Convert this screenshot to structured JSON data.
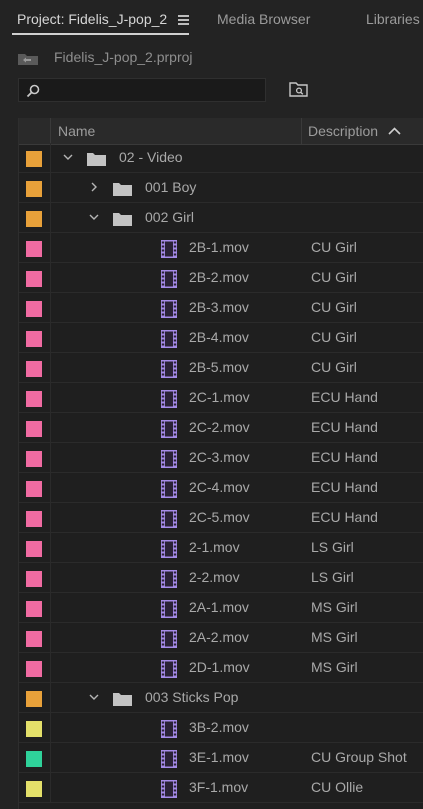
{
  "tabs": [
    {
      "label": "Project: Fidelis_J-pop_2",
      "active": true
    },
    {
      "label": "Media Browser",
      "active": false
    },
    {
      "label": "Libraries",
      "active": false
    }
  ],
  "project": {
    "file_name": "Fidelis_J-pop_2.prproj",
    "icon": "project-bin-icon"
  },
  "search": {
    "value": "",
    "icon": "search-icon"
  },
  "new_bin_icon": "new-bin-icon",
  "table": {
    "columns": {
      "name": "Name",
      "description": "Description"
    },
    "sort": {
      "column": "Description",
      "direction": "ascending"
    },
    "rows": [
      {
        "type": "folder",
        "level": 0,
        "expanded": true,
        "label_color": "#e8a13a",
        "name": "02 - Video",
        "description": ""
      },
      {
        "type": "folder",
        "level": 1,
        "expanded": false,
        "label_color": "#e8a13a",
        "name": "001 Boy",
        "description": ""
      },
      {
        "type": "folder",
        "level": 1,
        "expanded": true,
        "label_color": "#e8a13a",
        "name": "002 Girl",
        "description": ""
      },
      {
        "type": "clip",
        "level": 2,
        "label_color": "#f06ba2",
        "name": "2B-1.mov",
        "description": "CU Girl"
      },
      {
        "type": "clip",
        "level": 2,
        "label_color": "#f06ba2",
        "name": "2B-2.mov",
        "description": "CU Girl"
      },
      {
        "type": "clip",
        "level": 2,
        "label_color": "#f06ba2",
        "name": "2B-3.mov",
        "description": "CU Girl"
      },
      {
        "type": "clip",
        "level": 2,
        "label_color": "#f06ba2",
        "name": "2B-4.mov",
        "description": "CU Girl"
      },
      {
        "type": "clip",
        "level": 2,
        "label_color": "#f06ba2",
        "name": "2B-5.mov",
        "description": "CU Girl"
      },
      {
        "type": "clip",
        "level": 2,
        "label_color": "#f06ba2",
        "name": "2C-1.mov",
        "description": "ECU Hand"
      },
      {
        "type": "clip",
        "level": 2,
        "label_color": "#f06ba2",
        "name": "2C-2.mov",
        "description": "ECU Hand"
      },
      {
        "type": "clip",
        "level": 2,
        "label_color": "#f06ba2",
        "name": "2C-3.mov",
        "description": "ECU Hand"
      },
      {
        "type": "clip",
        "level": 2,
        "label_color": "#f06ba2",
        "name": "2C-4.mov",
        "description": "ECU Hand"
      },
      {
        "type": "clip",
        "level": 2,
        "label_color": "#f06ba2",
        "name": "2C-5.mov",
        "description": "ECU Hand"
      },
      {
        "type": "clip",
        "level": 2,
        "label_color": "#f06ba2",
        "name": "2-1.mov",
        "description": "LS Girl"
      },
      {
        "type": "clip",
        "level": 2,
        "label_color": "#f06ba2",
        "name": "2-2.mov",
        "description": "LS Girl"
      },
      {
        "type": "clip",
        "level": 2,
        "label_color": "#f06ba2",
        "name": "2A-1.mov",
        "description": "MS Girl"
      },
      {
        "type": "clip",
        "level": 2,
        "label_color": "#f06ba2",
        "name": "2A-2.mov",
        "description": "MS Girl"
      },
      {
        "type": "clip",
        "level": 2,
        "label_color": "#f06ba2",
        "name": "2D-1.mov",
        "description": "MS Girl"
      },
      {
        "type": "folder",
        "level": 1,
        "expanded": true,
        "label_color": "#e8a13a",
        "name": "003 Sticks Pop",
        "description": ""
      },
      {
        "type": "clip",
        "level": 2,
        "label_color": "#e4e06a",
        "name": "3B-2.mov",
        "description": ""
      },
      {
        "type": "clip",
        "level": 2,
        "label_color": "#2fd29a",
        "name": "3E-1.mov",
        "description": "CU Group Shot"
      },
      {
        "type": "clip",
        "level": 2,
        "label_color": "#e4e06a",
        "name": "3F-1.mov",
        "description": "CU Ollie"
      }
    ]
  },
  "colors": {
    "clip_icon": "#a58be8",
    "folder_icon": "#c3c3c3",
    "background": "#232323"
  }
}
